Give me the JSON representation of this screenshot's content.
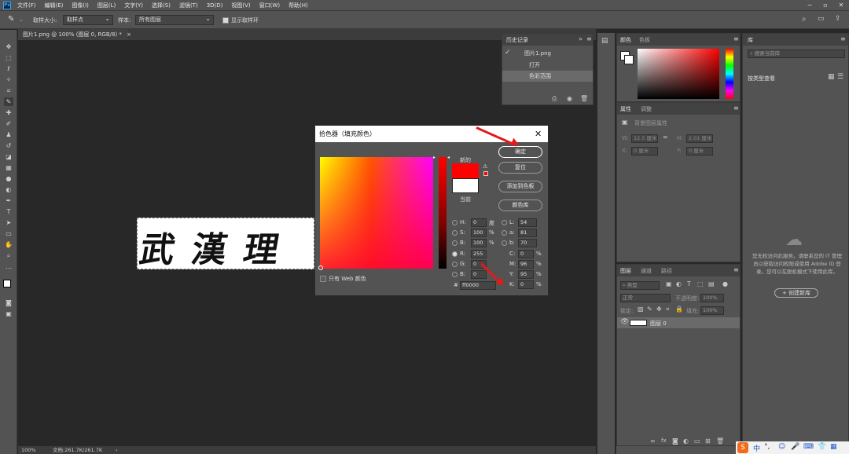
{
  "app": {
    "logo": "Ps"
  },
  "menu": [
    "文件(F)",
    "编辑(E)",
    "图像(I)",
    "图层(L)",
    "文字(Y)",
    "选择(S)",
    "滤镜(T)",
    "3D(D)",
    "视图(V)",
    "窗口(W)",
    "帮助(H)"
  ],
  "window_controls": [
    "−",
    "▫",
    "✕"
  ],
  "options": {
    "sample_size_label": "取样大小:",
    "sample_size_value": "取样点",
    "sample_label": "样本:",
    "sample_value": "所有图层",
    "show_ring_label": "显示取样环"
  },
  "document": {
    "tab_title": "图片1.png @ 100% (图层 0, RGB/8) *",
    "image_text": "武漢理"
  },
  "status": {
    "zoom": "100%",
    "doc_info": "文档:261.7K/261.7K"
  },
  "history": {
    "title": "历史记录",
    "snapshot": "图片1.png",
    "items": [
      "打开",
      "色彩范围"
    ]
  },
  "color_panel": {
    "tabs": [
      "颜色",
      "色板"
    ]
  },
  "properties_panel": {
    "tabs": [
      "属性",
      "调整"
    ],
    "no_props": "背景图层属性",
    "fields": {
      "W": "12.5 厘米",
      "H": "2.01 厘米",
      "X": "0 厘米",
      "Y": "0 厘米"
    }
  },
  "layers_panel": {
    "tabs": [
      "图层",
      "通道",
      "路径"
    ],
    "filter_placeholder": "类型",
    "blend": "正常",
    "opacity_label": "不透明度:",
    "opacity": "100%",
    "lock_label": "锁定:",
    "fill_label": "填充:",
    "fill": "100%",
    "layer_name": "图层 0"
  },
  "library_panel": {
    "tab": "库",
    "search_placeholder": "搜索当前库",
    "view_label": "按类型查看",
    "message": "您无权访问此服务。请联系您的 IT 管理员以获取访问权限或使用 Adobe ID 登录。您可以在脱机模式下使用此库。",
    "create_button": "+ 创建新库"
  },
  "color_picker": {
    "title": "拾色器（填充颜色）",
    "ok": "确定",
    "reset": "复位",
    "add_swatch": "添加到色板",
    "color_libraries": "颜色库",
    "new_label": "新的",
    "current_label": "当前",
    "web_only": "只有 Web 颜色",
    "H": "0",
    "H_unit": "度",
    "S": "100",
    "S_unit": "%",
    "B": "100",
    "B_unit": "%",
    "R": "255",
    "G": "0",
    "Bv": "0",
    "L": "54",
    "a": "81",
    "b": "70",
    "C": "0",
    "M": "96",
    "Y": "95",
    "K": "0",
    "hex": "ff0000",
    "new_color": "#ff0000",
    "current_color": "#ffffff"
  }
}
